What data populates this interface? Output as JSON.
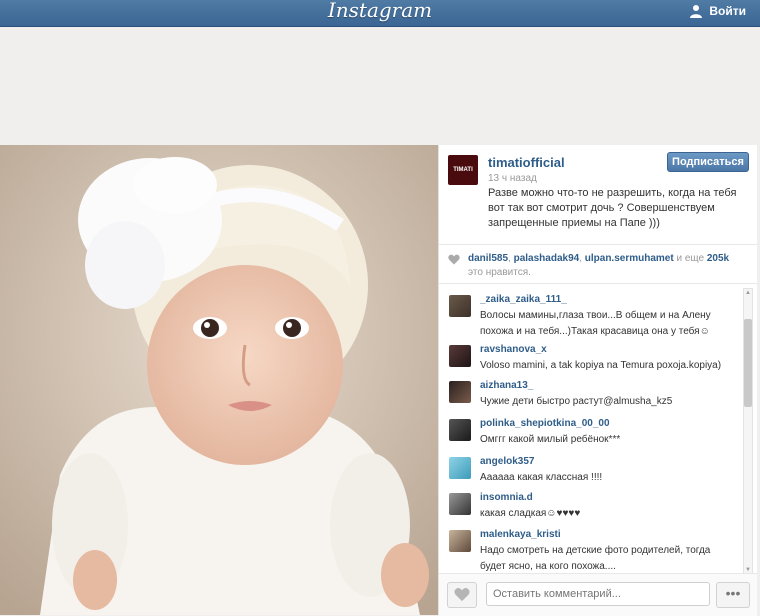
{
  "header": {
    "logo_text": "Instagram",
    "login_label": "Войти"
  },
  "post": {
    "username": "timatiofficial",
    "avatar_label": "TIMATI",
    "time": "13 ч назад",
    "caption": "Разве можно что-то не разрешить, когда на тебя вот так вот смотрит дочь ? Совершенствуем запрещенные приемы на Папе )))",
    "follow_label": "Подписаться"
  },
  "likes": {
    "users": [
      "danil585",
      "palashadak94",
      "ulpan.sermuhamet"
    ],
    "more_text": "и еще",
    "count": "205k",
    "suffix": "это нравится."
  },
  "comments": [
    {
      "user": "_zaika_zaika_111_",
      "text": "Волосы мамины,глаза твои...В общем и на Алену похожа и на тебя...)Такая красавица она у тебя☺"
    },
    {
      "user": "ravshanova_x",
      "text": "Voloso mamini, a tak kopiya na Temura poxoja.kopiya)"
    },
    {
      "user": "aizhana13_",
      "text": "Чужие дети быстро растут@almusha_kz5"
    },
    {
      "user": "polinka_shepiotkina_00_00",
      "text": "Омггг какой милый ребёнок***"
    },
    {
      "user": "angelok357",
      "text": "Аааааа какая классная !!!!"
    },
    {
      "user": "insomnia.d",
      "text": "какая сладкая☺♥♥♥♥"
    },
    {
      "user": "malenkaya_kristi",
      "text": "Надо смотреть на детские фото родителей, тогда будет ясно, на кого похожа...."
    }
  ],
  "comment_input": {
    "placeholder": "Оставить комментарий..."
  },
  "more_label": "•••",
  "colors": {
    "header": "#3b6594",
    "link": "#2f5d89",
    "follow_button": "#5583b3"
  },
  "icons": {
    "login": "person-icon",
    "like": "heart-icon",
    "likes_row": "heart-icon"
  }
}
